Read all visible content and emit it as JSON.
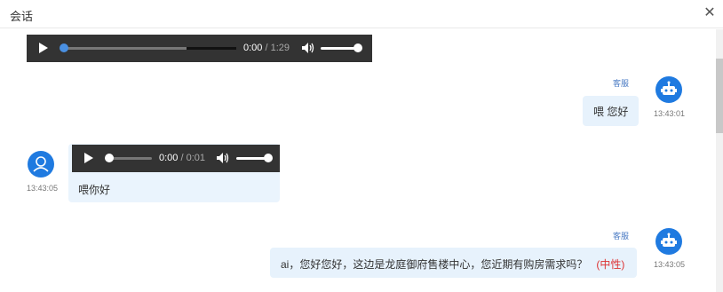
{
  "dialog": {
    "title": "会话",
    "close_glyph": "✕"
  },
  "messages": [
    {
      "kind": "audio-only",
      "audio": {
        "current": "0:00",
        "separator": "/",
        "duration": "1:29",
        "progress": 0.0,
        "volume": 0.9
      }
    },
    {
      "kind": "agent",
      "role": "客服",
      "text": "喂 您好",
      "time": "13:43:01",
      "avatar_icon": "robot-icon"
    },
    {
      "kind": "customer",
      "text": "喂你好",
      "time": "13:43:05",
      "avatar_icon": "user-icon",
      "audio": {
        "current": "0:00",
        "separator": "/",
        "duration": "0:01",
        "progress": 0.0,
        "volume": 0.9
      }
    },
    {
      "kind": "agent",
      "role": "客服",
      "text": "ai，您好您好，这边是龙庭御府售楼中心，您近期有购房需求吗？",
      "emotion": "(中性)",
      "time": "13:43:05",
      "avatar_icon": "robot-icon"
    }
  ],
  "colors": {
    "accent": "#1f7ae0",
    "bubble": "#e8f3fd",
    "emotion": "#dd3333",
    "player": "#333333"
  }
}
